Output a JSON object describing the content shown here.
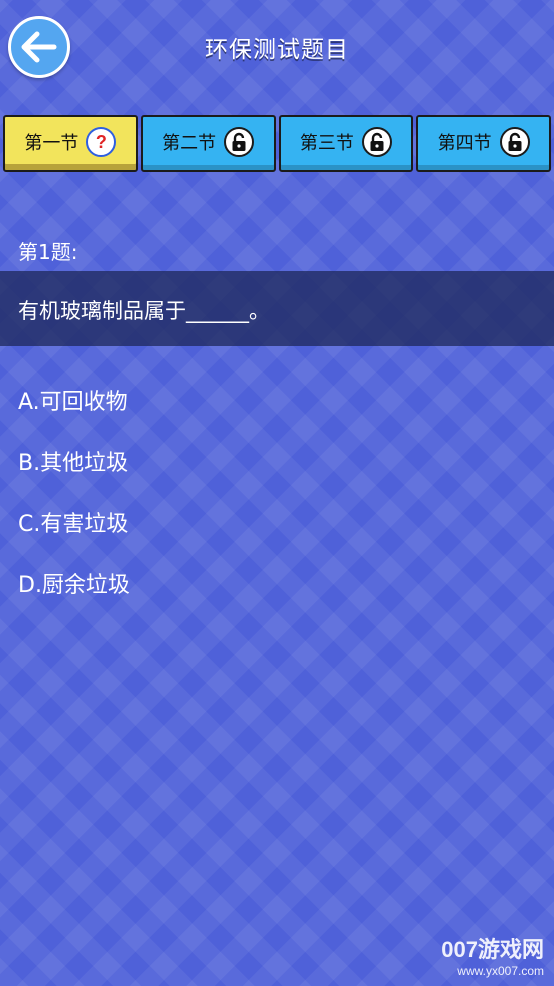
{
  "header": {
    "title": "环保测试题目",
    "back_icon": "arrow-left-icon"
  },
  "tabs": [
    {
      "label": "第一节",
      "icon": "question-icon",
      "active": true
    },
    {
      "label": "第二节",
      "icon": "lock-icon",
      "active": false
    },
    {
      "label": "第三节",
      "icon": "lock-icon",
      "active": false
    },
    {
      "label": "第四节",
      "icon": "lock-icon",
      "active": false
    }
  ],
  "question": {
    "number": "第1题:",
    "text": "有机玻璃制品属于______。"
  },
  "options": [
    "A.可回收物",
    "B.其他垃圾",
    "C.有害垃圾",
    "D.厨余垃圾"
  ],
  "watermark": {
    "main": "007游戏网",
    "sub": "www.yx007.com"
  },
  "colors": {
    "background": "#4f61d9",
    "tab_active": "#f2e45c",
    "tab_inactive": "#35b3f2",
    "back_button": "#54a6f0",
    "question_mark": "#e02525"
  }
}
